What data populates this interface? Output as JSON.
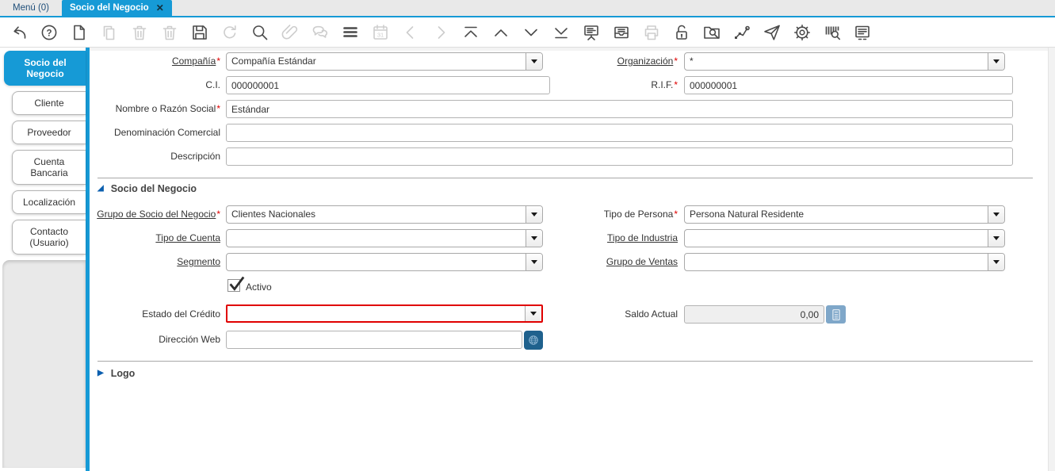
{
  "tabbar": {
    "menu_tab": "Menú (0)",
    "active_tab": "Socio del Negocio"
  },
  "icons": {
    "close": "✕",
    "section_expanded": "◢",
    "section_collapsed": "▶"
  },
  "toolbar": {
    "icons": [
      {
        "name": "undo-icon",
        "enabled": true
      },
      {
        "name": "help-icon",
        "enabled": true
      },
      {
        "name": "new-record-icon",
        "enabled": true
      },
      {
        "name": "copy-record-icon",
        "enabled": false
      },
      {
        "name": "delete-record-icon",
        "enabled": false
      },
      {
        "name": "delete-selection-icon",
        "enabled": false
      },
      {
        "name": "save-icon",
        "enabled": true
      },
      {
        "name": "refresh-icon",
        "enabled": false
      },
      {
        "name": "find-icon",
        "enabled": true
      },
      {
        "name": "attachment-icon",
        "enabled": false
      },
      {
        "name": "chat-icon",
        "enabled": false
      },
      {
        "name": "grid-toggle-icon",
        "enabled": true
      },
      {
        "name": "calendar-icon",
        "enabled": false
      },
      {
        "name": "parent-record-icon",
        "enabled": false
      },
      {
        "name": "detail-record-icon",
        "enabled": false
      },
      {
        "name": "first-record-icon",
        "enabled": true
      },
      {
        "name": "previous-record-icon",
        "enabled": true
      },
      {
        "name": "next-record-icon",
        "enabled": true
      },
      {
        "name": "last-record-icon",
        "enabled": true
      },
      {
        "name": "report-icon",
        "enabled": true
      },
      {
        "name": "archive-icon",
        "enabled": true
      },
      {
        "name": "print-icon",
        "enabled": false
      },
      {
        "name": "lock-icon",
        "enabled": true
      },
      {
        "name": "zoom-across-icon",
        "enabled": true
      },
      {
        "name": "workflow-icon",
        "enabled": true
      },
      {
        "name": "share-icon",
        "enabled": true
      },
      {
        "name": "preferences-icon",
        "enabled": true
      },
      {
        "name": "product-info-icon",
        "enabled": true
      },
      {
        "name": "quick-form-icon",
        "enabled": true
      }
    ]
  },
  "sidebar": {
    "tabs": [
      {
        "label": "Socio del Negocio",
        "active": true
      },
      {
        "label": "Cliente",
        "active": false
      },
      {
        "label": "Proveedor",
        "active": false
      },
      {
        "label": "Cuenta Bancaria",
        "active": false
      },
      {
        "label": "Localización",
        "active": false
      },
      {
        "label": "Contacto (Usuario)",
        "active": false
      }
    ]
  },
  "form": {
    "compania": {
      "label": "Compañía",
      "mandatory": "*",
      "value": "Compañía Estándar"
    },
    "organizacion": {
      "label": "Organización",
      "mandatory": "*",
      "value": "*"
    },
    "ci": {
      "label": "C.I.",
      "value": "000000001"
    },
    "rif": {
      "label": "R.I.F.",
      "mandatory": "*",
      "value": "000000001"
    },
    "nombre": {
      "label": "Nombre o Razón Social",
      "mandatory": "*",
      "value": "Estándar"
    },
    "denominacion": {
      "label": "Denominación Comercial",
      "value": ""
    },
    "descripcion": {
      "label": "Descripción",
      "value": ""
    },
    "section_socio": {
      "label": "Socio del Negocio"
    },
    "grupo_socio": {
      "label": "Grupo de Socio del Negocio",
      "mandatory": "*",
      "value": "Clientes Nacionales"
    },
    "tipo_persona": {
      "label": "Tipo de Persona",
      "mandatory": "*",
      "value": "Persona Natural Residente"
    },
    "tipo_cuenta": {
      "label": "Tipo de Cuenta",
      "value": ""
    },
    "tipo_industria": {
      "label": "Tipo de Industria",
      "value": ""
    },
    "segmento": {
      "label": "Segmento",
      "value": ""
    },
    "grupo_ventas": {
      "label": "Grupo de Ventas",
      "value": ""
    },
    "activo": {
      "label": "Activo",
      "checked": true
    },
    "estado_credito": {
      "label": "Estado del Crédito",
      "value": ""
    },
    "saldo_actual": {
      "label": "Saldo Actual",
      "value": "0,00"
    },
    "direccion_web": {
      "label": "Dirección Web",
      "value": ""
    },
    "section_logo": {
      "label": "Logo"
    }
  },
  "colors": {
    "accent_blue": "#169AD6",
    "mandatory_red": "#E00000",
    "error_border": "#E00000",
    "globe_button_blue": "#1F618D",
    "calculator_button_blue": "#7FA7C9"
  }
}
